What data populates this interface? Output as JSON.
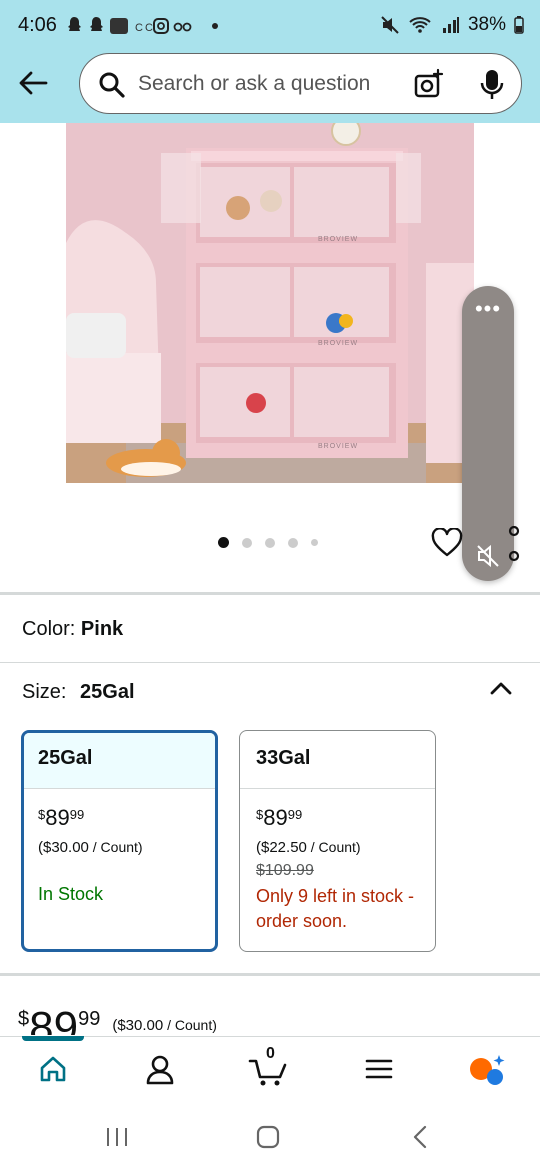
{
  "status_bar": {
    "time": "4:06",
    "battery": "38%"
  },
  "search": {
    "placeholder": "Search or ask a question"
  },
  "carousel": {
    "count": 5,
    "active_index": 0,
    "brand_label": "BROVIEW"
  },
  "color": {
    "label": "Color:",
    "value": "Pink"
  },
  "size": {
    "label": "Size:",
    "value": "25Gal"
  },
  "options": [
    {
      "name": "25Gal",
      "price_symbol": "$",
      "price_whole": "89",
      "price_fraction": "99",
      "per_unit_open": "($30.00",
      "per_unit_close": " / Count)",
      "stock": "In Stock",
      "selected": true
    },
    {
      "name": "33Gal",
      "price_symbol": "$",
      "price_whole": "89",
      "price_fraction": "99",
      "per_unit_open": "($22.50",
      "per_unit_close": " / Count)",
      "list_price": "$109.99",
      "stock": "Only 9 left in stock - order soon.",
      "selected": false
    }
  ],
  "bottom_price": {
    "symbol": "$",
    "whole": "89",
    "fraction": "99",
    "per_unit_open": "($30.00",
    "per_unit_close": " / Count)"
  },
  "nav": {
    "cart_count": "0",
    "active": "home"
  },
  "colors": {
    "header_bg": "#a9e2ec",
    "selected_border": "#2162a1",
    "in_stock": "#007600",
    "low_stock": "#b12704",
    "nav_active": "#007185"
  }
}
